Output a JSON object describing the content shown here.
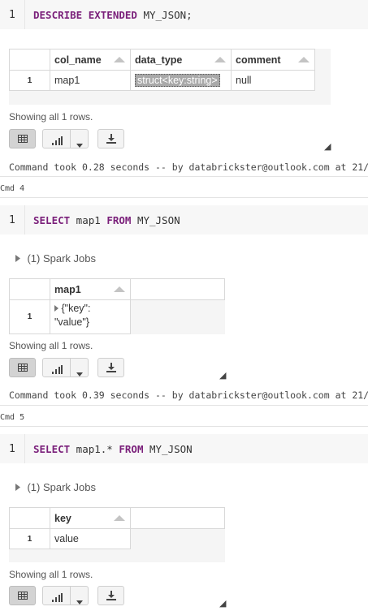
{
  "cells": [
    {
      "line_number": "1",
      "code_tokens": [
        {
          "text": "DESCRIBE EXTENDED",
          "kw": true
        },
        {
          "text": " MY_JSON;",
          "kw": false
        }
      ],
      "table": {
        "headers": [
          "col_name",
          "data_type",
          "comment"
        ],
        "rows": [
          {
            "num": "1",
            "cells": [
              "map1",
              "struct<key:string>",
              "null"
            ]
          }
        ]
      },
      "showing": "Showing all 1 rows.",
      "command_took": "Command took 0.28 seconds -- by databrickster@outlook.com at 21/04/"
    },
    {
      "cmd_label": "Cmd 4",
      "line_number": "1",
      "code_tokens": [
        {
          "text": "SELECT",
          "kw": true
        },
        {
          "text": " map1 ",
          "kw": false
        },
        {
          "text": "FROM",
          "kw": true
        },
        {
          "text": " MY_JSON",
          "kw": false
        }
      ],
      "spark_jobs": "(1) Spark Jobs",
      "table": {
        "headers": [
          "map1"
        ],
        "rows": [
          {
            "num": "1",
            "cells": [
              "{\"key\": \"value\"}"
            ]
          }
        ]
      },
      "showing": "Showing all 1 rows.",
      "command_took": "Command took 0.39 seconds -- by databrickster@outlook.com at 21/04/"
    },
    {
      "cmd_label": "Cmd 5",
      "line_number": "1",
      "code_tokens": [
        {
          "text": "SELECT",
          "kw": true
        },
        {
          "text": " map1.* ",
          "kw": false
        },
        {
          "text": "FROM",
          "kw": true
        },
        {
          "text": " MY_JSON",
          "kw": false
        }
      ],
      "spark_jobs": "(1) Spark Jobs",
      "table": {
        "headers": [
          "key"
        ],
        "rows": [
          {
            "num": "1",
            "cells": [
              "value"
            ]
          }
        ]
      },
      "showing": "Showing all 1 rows."
    }
  ],
  "icons": {
    "table_view": "table-grid-icon",
    "chart": "bar-chart-icon",
    "dropdown": "caret-down-icon",
    "download": "download-icon",
    "expand": "caret-right-icon",
    "resize": "resize-handle-icon"
  }
}
